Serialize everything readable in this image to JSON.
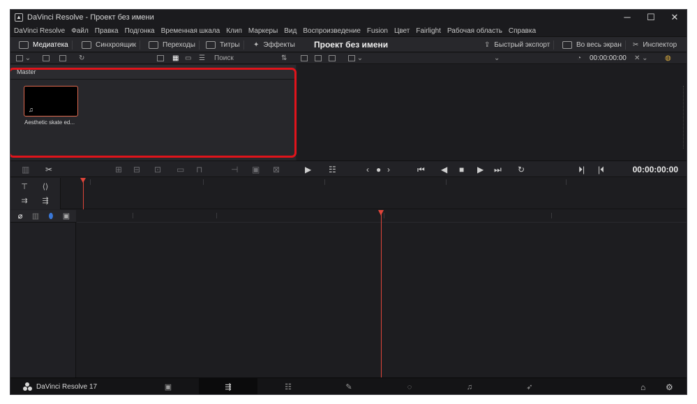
{
  "window": {
    "title": "DaVinci Resolve - Проект без имени",
    "minimize": "─",
    "maximize": "☐",
    "close": "✕"
  },
  "menu": [
    "DaVinci Resolve",
    "Файл",
    "Правка",
    "Подгонка",
    "Временная шкала",
    "Клип",
    "Маркеры",
    "Вид",
    "Воспроизведение",
    "Fusion",
    "Цвет",
    "Fairlight",
    "Рабочая область",
    "Справка"
  ],
  "pagebar": {
    "media_pool": "Медиатека",
    "sync": "Синхроящик",
    "transitions": "Переходы",
    "titles": "Титры",
    "effects": "Эффекты",
    "project_title": "Проект без имени",
    "quick_export": "Быстрый экспорт",
    "fullscreen": "Во весь экран",
    "inspector": "Инспектор"
  },
  "toolbar": {
    "search": "Поиск",
    "timecode": "00:00:00:00"
  },
  "media_pool": {
    "bin": "Master",
    "clips": [
      {
        "name": "Aesthetic skate ed...",
        "type": "audio"
      }
    ]
  },
  "transport": {
    "timecode": "00:00:00:00"
  },
  "bottombar": {
    "brand": "DaVinci Resolve 17"
  },
  "colors": {
    "accent": "#e04a3a",
    "highlight": "#e0141b",
    "background": "#1f1f23"
  }
}
